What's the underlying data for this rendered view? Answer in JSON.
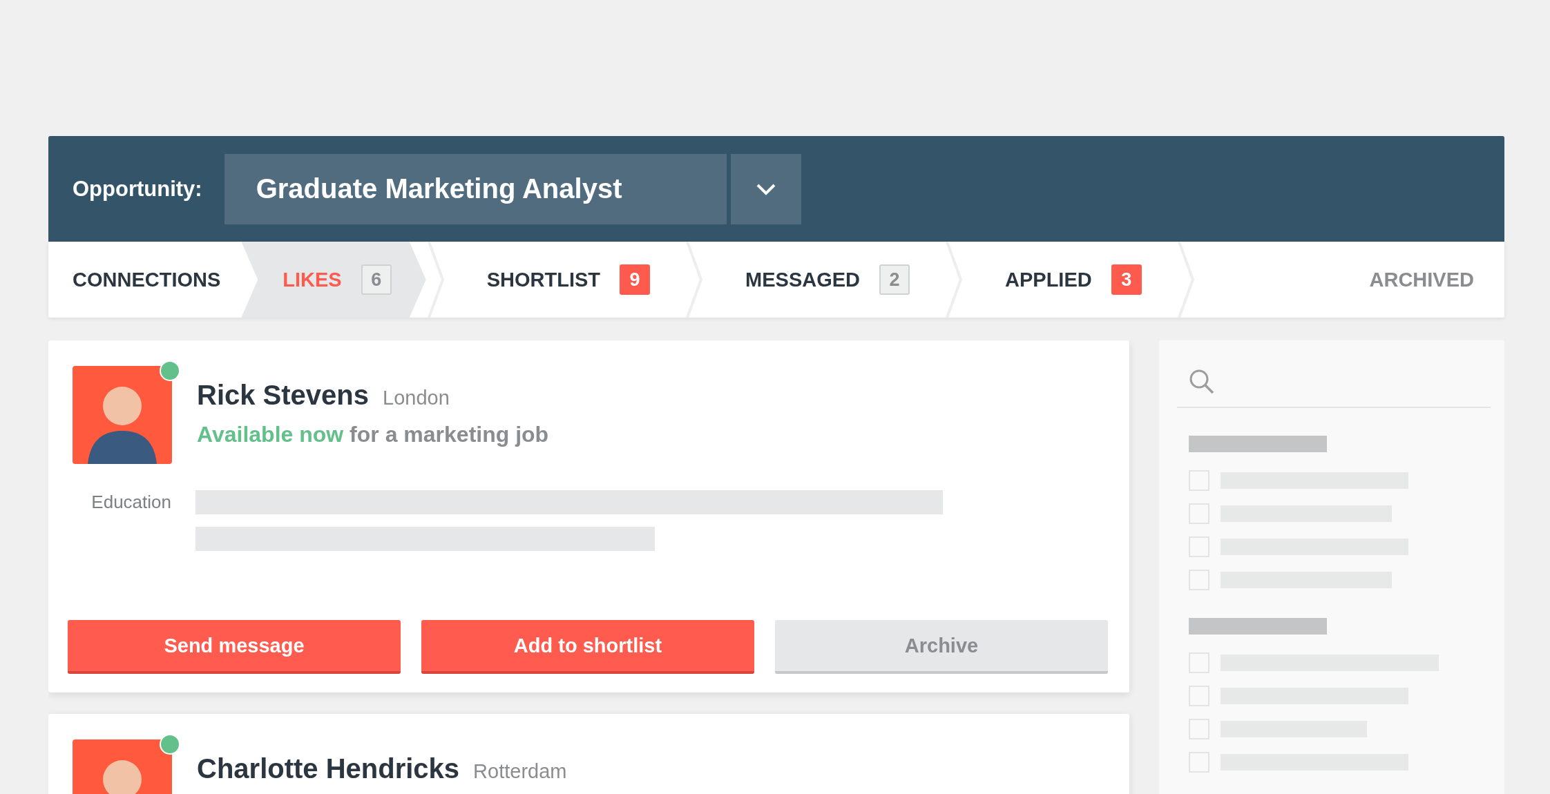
{
  "header": {
    "label": "Opportunity:",
    "selected_opportunity": "Graduate Marketing Analyst"
  },
  "tabs": [
    {
      "label": "CONNECTIONS",
      "selected": false
    },
    {
      "label": "LIKES",
      "selected": true,
      "badge": {
        "count": "6",
        "highlighted": false
      }
    },
    {
      "label": "SHORTLIST",
      "selected": false,
      "badge": {
        "count": "9",
        "highlighted": true
      }
    },
    {
      "label": "MESSAGED",
      "selected": false,
      "badge": {
        "count": "2",
        "highlighted": false
      }
    },
    {
      "label": "APPLIED",
      "selected": false,
      "badge": {
        "count": "3",
        "highlighted": true
      }
    }
  ],
  "archived_tab": {
    "label": "ARCHIVED",
    "selected": false
  },
  "candidates": [
    {
      "name": "Rick Stevens",
      "location": "London",
      "online": true,
      "availability": "Available now",
      "availability_detail": "for a marketing job",
      "education_label": "Education",
      "buttons": [
        {
          "label": "Send message",
          "kind": "primary"
        },
        {
          "label": "Add to shortlist",
          "kind": "primary"
        },
        {
          "label": "Archive",
          "kind": "secondary"
        }
      ]
    },
    {
      "name": "Charlotte Hendricks",
      "location": "Rotterdam",
      "online": true
    }
  ],
  "filter_groups": [
    {
      "options": [
        {
          "checked": false
        },
        {
          "checked": false
        },
        {
          "checked": false
        },
        {
          "checked": false
        }
      ]
    },
    {
      "options": [
        {
          "checked": false
        },
        {
          "checked": false
        },
        {
          "checked": false
        },
        {
          "checked": false
        }
      ]
    }
  ]
}
